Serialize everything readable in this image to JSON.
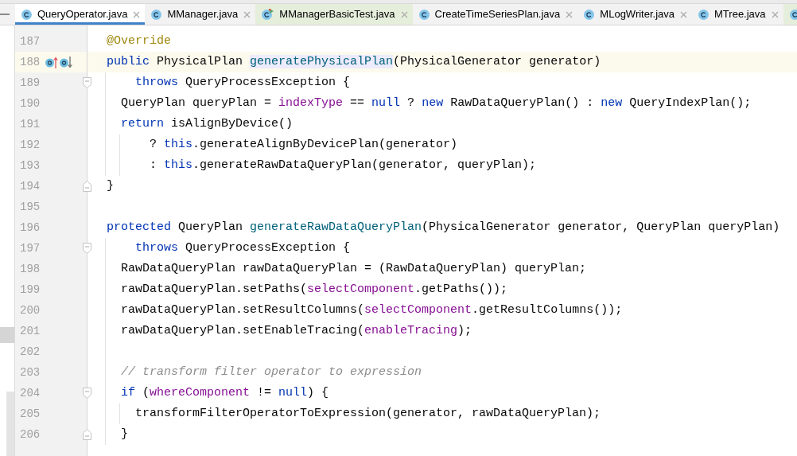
{
  "tabs": [
    {
      "label": "QueryOperator.java",
      "kind": "source",
      "selected": true
    },
    {
      "label": "MManager.java",
      "kind": "source",
      "selected": false
    },
    {
      "label": "MManagerBasicTest.java",
      "kind": "test",
      "selected": false
    },
    {
      "label": "CreateTimeSeriesPlan.java",
      "kind": "source",
      "selected": false
    },
    {
      "label": "MLogWriter.java",
      "kind": "source",
      "selected": false
    },
    {
      "label": "MTree.java",
      "kind": "source",
      "selected": false
    },
    {
      "kind": "test",
      "selected": false
    }
  ],
  "lines": [
    {
      "number": "187",
      "current": false,
      "tokens": [
        {
          "text": "  @Override",
          "kind": "annotation"
        }
      ]
    },
    {
      "number": "188",
      "current": true,
      "gutter_marks": [
        {
          "kind": "up"
        },
        {
          "kind": "down"
        }
      ],
      "tokens": [
        {
          "text": "  public",
          "kind": "keyword"
        },
        {
          "text": " PhysicalPlan ",
          "kind": "plain"
        },
        {
          "text": "generatePhysicalPlan",
          "kind": "highlighted"
        },
        {
          "text": "(PhysicalGenerator generator)",
          "kind": "plain"
        }
      ]
    },
    {
      "number": "189",
      "current": false,
      "fold": {
        "kind": "start"
      },
      "tokens": [
        {
          "text": "      throws",
          "kind": "keyword"
        },
        {
          "text": " QueryProcessException {",
          "kind": "plain"
        }
      ]
    },
    {
      "number": "190",
      "current": false,
      "tokens": [
        {
          "text": "    QueryPlan queryPlan = ",
          "kind": "plain"
        },
        {
          "text": "indexType",
          "kind": "field"
        },
        {
          "text": " == ",
          "kind": "plain"
        },
        {
          "text": "null",
          "kind": "keyword"
        },
        {
          "text": " ? ",
          "kind": "plain"
        },
        {
          "text": "new",
          "kind": "keyword"
        },
        {
          "text": " RawDataQueryPlan() : ",
          "kind": "plain"
        },
        {
          "text": "new",
          "kind": "keyword"
        },
        {
          "text": " QueryIndexPlan();",
          "kind": "plain"
        }
      ]
    },
    {
      "number": "191",
      "current": false,
      "tokens": [
        {
          "text": "    return",
          "kind": "keyword"
        },
        {
          "text": " isAlignByDevice()",
          "kind": "plain"
        }
      ]
    },
    {
      "number": "192",
      "current": false,
      "tokens": [
        {
          "text": "        ? ",
          "kind": "plain"
        },
        {
          "text": "this",
          "kind": "keyword"
        },
        {
          "text": ".generateAlignByDevicePlan(generator)",
          "kind": "plain"
        }
      ]
    },
    {
      "number": "193",
      "current": false,
      "tokens": [
        {
          "text": "        : ",
          "kind": "plain"
        },
        {
          "text": "this",
          "kind": "keyword"
        },
        {
          "text": ".generateRawDataQueryPlan(generator, queryPlan);",
          "kind": "plain"
        }
      ]
    },
    {
      "number": "194",
      "current": false,
      "fold": {
        "kind": "end"
      },
      "tokens": [
        {
          "text": "  }",
          "kind": "plain"
        }
      ]
    },
    {
      "number": "195",
      "current": false
    },
    {
      "number": "196",
      "current": false,
      "tokens": [
        {
          "text": "  protected",
          "kind": "keyword"
        },
        {
          "text": " QueryPlan ",
          "kind": "plain"
        },
        {
          "text": "generateRawDataQueryPlan",
          "kind": "declaration"
        },
        {
          "text": "(PhysicalGenerator generator, QueryPlan queryPlan)",
          "kind": "plain"
        }
      ]
    },
    {
      "number": "197",
      "current": false,
      "fold": {
        "kind": "start"
      },
      "tokens": [
        {
          "text": "      throws",
          "kind": "keyword"
        },
        {
          "text": " QueryProcessException {",
          "kind": "plain"
        }
      ]
    },
    {
      "number": "198",
      "current": false,
      "tokens": [
        {
          "text": "    RawDataQueryPlan rawDataQueryPlan = (RawDataQueryPlan) queryPlan;",
          "kind": "plain"
        }
      ]
    },
    {
      "number": "199",
      "current": false,
      "tokens": [
        {
          "text": "    rawDataQueryPlan.setPaths(",
          "kind": "plain"
        },
        {
          "text": "selectComponent",
          "kind": "field"
        },
        {
          "text": ".getPaths());",
          "kind": "plain"
        }
      ]
    },
    {
      "number": "200",
      "current": false,
      "tokens": [
        {
          "text": "    rawDataQueryPlan.setResultColumns(",
          "kind": "plain"
        },
        {
          "text": "selectComponent",
          "kind": "field"
        },
        {
          "text": ".getResultColumns());",
          "kind": "plain"
        }
      ]
    },
    {
      "number": "201",
      "current": false,
      "tokens": [
        {
          "text": "    rawDataQueryPlan.setEnableTracing(",
          "kind": "plain"
        },
        {
          "text": "enableTracing",
          "kind": "field"
        },
        {
          "text": ");",
          "kind": "plain"
        }
      ]
    },
    {
      "number": "202",
      "current": false
    },
    {
      "number": "203",
      "current": false,
      "tokens": [
        {
          "text": "    // transform filter operator to expression",
          "kind": "comment"
        }
      ]
    },
    {
      "number": "204",
      "current": false,
      "fold": {
        "kind": "start"
      },
      "tokens": [
        {
          "text": "    if",
          "kind": "keyword"
        },
        {
          "text": " (",
          "kind": "plain"
        },
        {
          "text": "whereComponent",
          "kind": "field"
        },
        {
          "text": " != ",
          "kind": "plain"
        },
        {
          "text": "null",
          "kind": "keyword"
        },
        {
          "text": ") {",
          "kind": "plain"
        }
      ]
    },
    {
      "number": "205",
      "current": false,
      "tokens": [
        {
          "text": "      transformFilterOperatorToExpression(generator, rawDataQueryPlan);",
          "kind": "plain"
        }
      ]
    },
    {
      "number": "206",
      "current": false,
      "fold": {
        "kind": "end"
      },
      "tokens": [
        {
          "text": "    }",
          "kind": "plain"
        }
      ]
    }
  ]
}
